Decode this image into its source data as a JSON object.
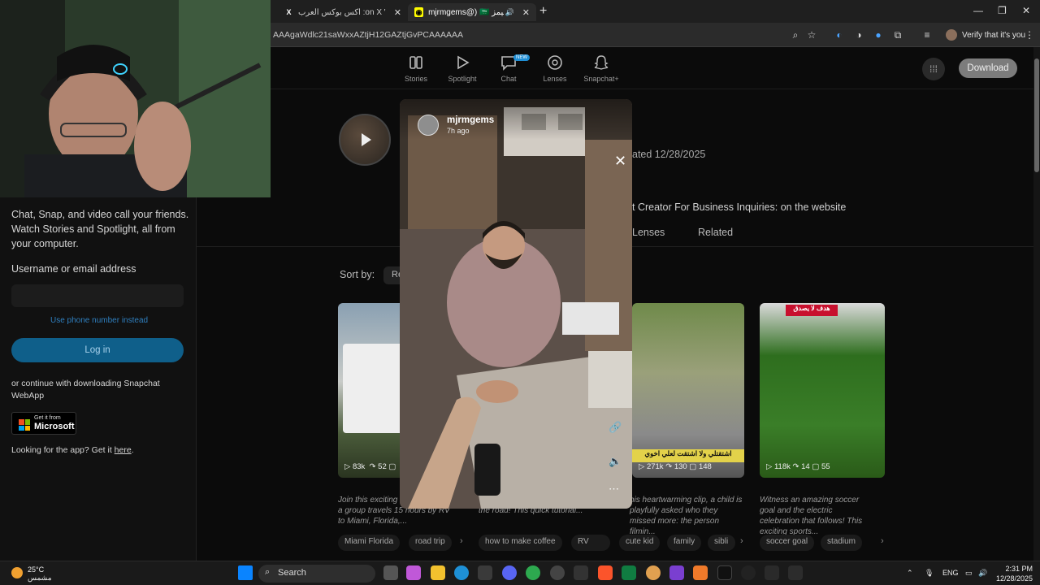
{
  "browser": {
    "tabs": [
      {
        "title": "اكس بوكس العرب :on X \"بعد ش...",
        "favicon": "X"
      },
      {
        "title": "mjrmgems@) 🇸🇦 مجرم قيمز",
        "favicon": "snapchat"
      }
    ],
    "address": "AAAgaWdlc21saWxxAZtjH12GAZtjGvPCAAAAAA",
    "profile_label": "Verify that it's you"
  },
  "sidebar": {
    "tagline": "Chat, Snap, and video call your friends. Watch Stories and Spotlight, all from your computer.",
    "username_label": "Username or email address",
    "phone_link": "Use phone number instead",
    "login_button": "Log in",
    "continue_text": "or continue with downloading Snapchat WebApp",
    "ms_small": "Get it from",
    "ms_big": "Microsoft",
    "app_text": "Looking for the app? Get it",
    "app_link": "here"
  },
  "nav": {
    "items": [
      {
        "label": "Stories",
        "icon": "stories-icon"
      },
      {
        "label": "Spotlight",
        "icon": "spotlight-icon"
      },
      {
        "label": "Chat",
        "icon": "chat-icon",
        "badge": "NEW"
      },
      {
        "label": "Lenses",
        "icon": "lenses-icon"
      },
      {
        "label": "Snapchat+",
        "icon": "ghost-icon"
      }
    ],
    "download": "Download"
  },
  "profile": {
    "created": "ated 12/28/2025",
    "bio": "t Creator For Business Inquiries: on the website",
    "tabs": [
      "Lenses",
      "Related"
    ],
    "sort_label": "Sort by:",
    "sort_value": "Re"
  },
  "cards": [
    {
      "views": "83k",
      "shares": "52",
      "comments": "",
      "desc": "Join this exciting adventure as a group travels 15 hours by RV to Miami, Florida,...",
      "tags": [
        "Miami Florida",
        "road trip"
      ]
    },
    {
      "views": "",
      "shares": "",
      "comments": "",
      "desc": "cup of American coffee while on the road! This quick tutorial...",
      "tags": [
        "how to make coffee",
        "RV"
      ]
    },
    {
      "views": "271k",
      "shares": "130",
      "comments": "148",
      "desc": "his heartwarming clip, a child is playfully asked who they missed more: the person filmin...",
      "tags": [
        "cute kid",
        "family",
        "sibli"
      ],
      "caption": "اشتقتلي ولا اشتقت لعلي اخوي"
    },
    {
      "views": "118k",
      "shares": "14",
      "comments": "55",
      "desc": "Witness an amazing soccer goal and the electric celebration that follows! This exciting sports...",
      "tags": [
        "soccer goal",
        "stadium"
      ],
      "caption": "هدف لا يصدق"
    }
  ],
  "story": {
    "username": "mjrmgems",
    "time": "7h ago"
  },
  "taskbar": {
    "temp": "25°C",
    "condition": "مشمس",
    "search": "Search",
    "lang": "ENG",
    "time": "2:31 PM",
    "date": "12/28/2025"
  },
  "colors": {
    "login": "#0f5f8a",
    "download": "#7c7c7c",
    "link": "#2f7fbf"
  }
}
